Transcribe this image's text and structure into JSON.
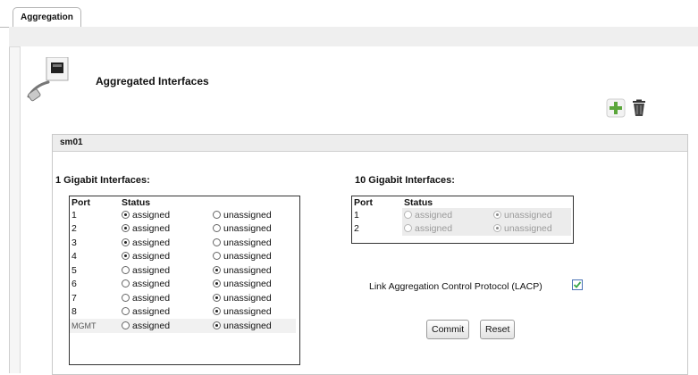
{
  "tabs": [
    {
      "label": "Aggregation"
    }
  ],
  "page": {
    "title": "Aggregated Interfaces",
    "icon": "network-port-icon"
  },
  "toolbar": {
    "add_icon": "plus-icon",
    "delete_icon": "trash-can-icon",
    "add_color": "#5aa63a"
  },
  "panel": {
    "title": "sm01",
    "one_gig": {
      "label": "1 Gigabit Interfaces:",
      "headers": {
        "port": "Port",
        "status": "Status"
      },
      "option_assigned": "assigned",
      "option_unassigned": "unassigned",
      "rows": [
        {
          "port": "1",
          "status": "assigned"
        },
        {
          "port": "2",
          "status": "assigned"
        },
        {
          "port": "3",
          "status": "assigned"
        },
        {
          "port": "4",
          "status": "assigned"
        },
        {
          "port": "5",
          "status": "unassigned"
        },
        {
          "port": "6",
          "status": "unassigned"
        },
        {
          "port": "7",
          "status": "unassigned"
        },
        {
          "port": "8",
          "status": "unassigned"
        },
        {
          "port": "MGMT",
          "status": "unassigned"
        }
      ]
    },
    "ten_gig": {
      "label": "10 Gigabit Interfaces:",
      "headers": {
        "port": "Port",
        "status": "Status"
      },
      "option_assigned": "assigned",
      "option_unassigned": "unassigned",
      "disabled": true,
      "rows": [
        {
          "port": "1",
          "status": "unassigned"
        },
        {
          "port": "2",
          "status": "unassigned"
        }
      ]
    },
    "lacp": {
      "label": "Link Aggregation Control Protocol (LACP)",
      "checked": true
    },
    "buttons": {
      "commit": "Commit",
      "reset": "Reset"
    }
  }
}
